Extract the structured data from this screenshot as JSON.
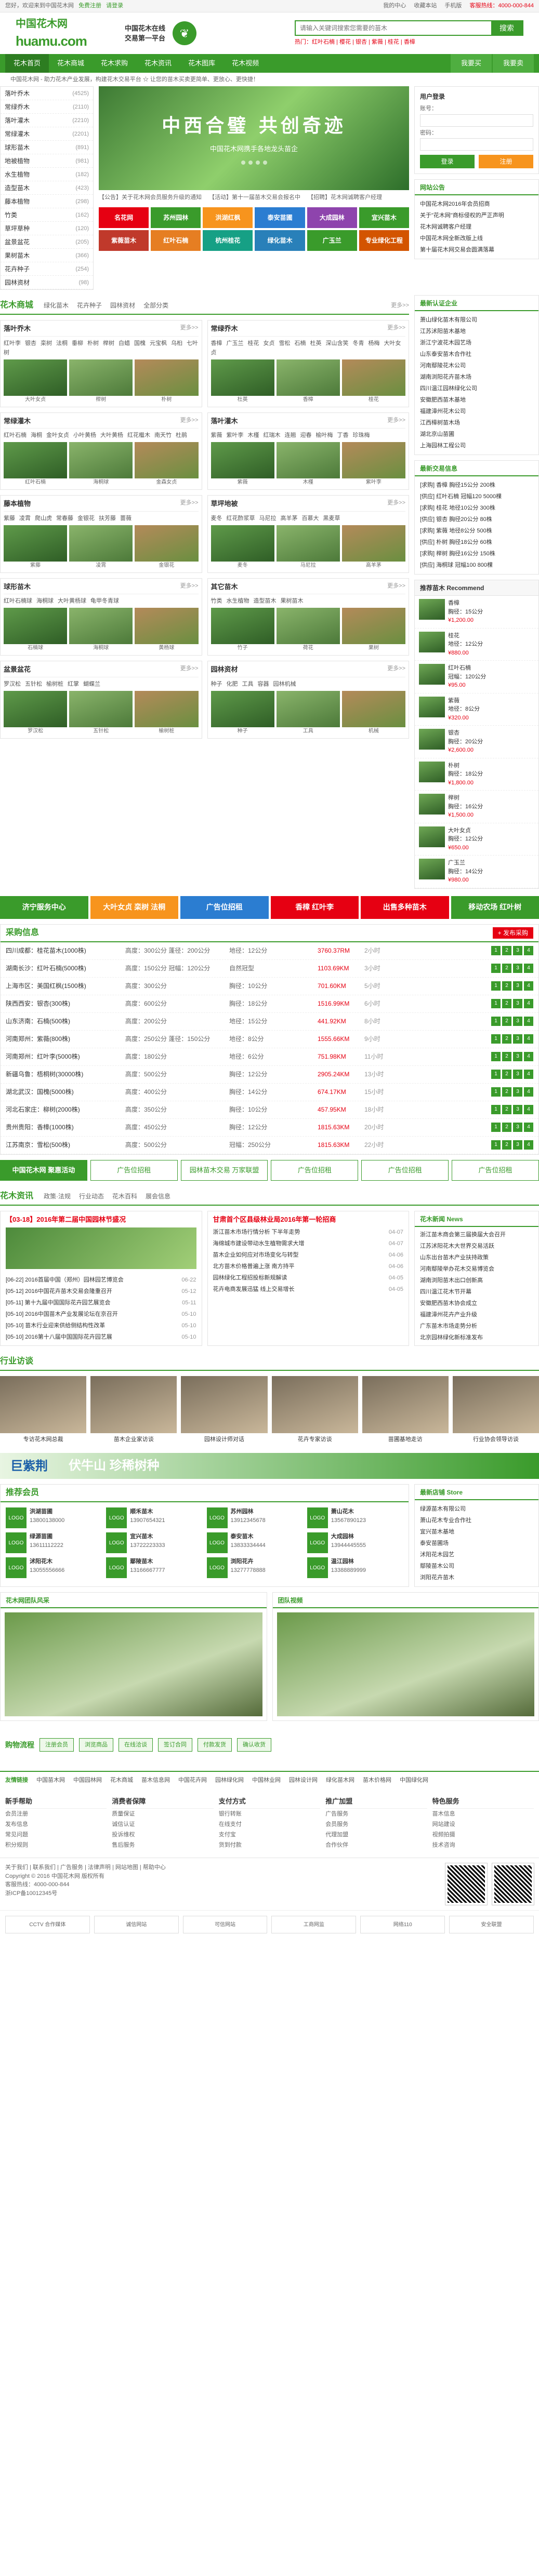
{
  "topbar": {
    "left": [
      "您好，欢迎来到中国花木网",
      "免费注册",
      "请登录"
    ],
    "right": [
      "我的中心",
      "收藏本站",
      "手机版",
      "客服热线：4000-000-844"
    ]
  },
  "logo": {
    "cn": "中国花木网",
    "en": "huamu.com"
  },
  "slogan": [
    "中国花木在线",
    "交易第一平台"
  ],
  "search": {
    "placeholder": "请输入关键词搜索您需要的苗木",
    "button": "搜索",
    "hot": "热门：红叶石楠 | 樱花 | 银杏 | 紫薇 | 桂花 | 香樟"
  },
  "nav": {
    "items": [
      "花木首页",
      "花木商城",
      "花木求购",
      "花木资讯",
      "花木图库",
      "花木视频"
    ],
    "right": [
      "我要买",
      "我要卖"
    ]
  },
  "ticker": "中国花木网 - 助力花木产业发展，构建花木交易平台 ☆ 让您的苗木买卖更简单、更放心、更快捷！",
  "categories": [
    {
      "name": "落叶乔木",
      "count": "(4525)"
    },
    {
      "name": "常绿乔木",
      "count": "(2110)"
    },
    {
      "name": "落叶灌木",
      "count": "(2210)"
    },
    {
      "name": "常绿灌木",
      "count": "(2201)"
    },
    {
      "name": "球形苗木",
      "count": "(891)"
    },
    {
      "name": "地被植物",
      "count": "(981)"
    },
    {
      "name": "水生植物",
      "count": "(182)"
    },
    {
      "name": "造型苗木",
      "count": "(423)"
    },
    {
      "name": "藤本植物",
      "count": "(298)"
    },
    {
      "name": "竹类",
      "count": "(162)"
    },
    {
      "name": "草坪草种",
      "count": "(120)"
    },
    {
      "name": "盆景盆花",
      "count": "(205)"
    },
    {
      "name": "果树苗木",
      "count": "(366)"
    },
    {
      "name": "花卉种子",
      "count": "(254)"
    },
    {
      "name": "园林资材",
      "count": "(98)"
    }
  ],
  "banner": {
    "title": "中西合璧 共创奇迹",
    "subtitle": "中国花木网携手各地龙头苗企"
  },
  "notices": [
    "【公告】关于花木网会员服务升级的通知",
    "【活动】第十一届苗木交易会报名中",
    "【招聘】花木网诚聘客户经理"
  ],
  "ads": [
    {
      "text": "名花网",
      "color": "#e60012"
    },
    {
      "text": "苏州园林",
      "color": "#3a9b2b"
    },
    {
      "text": "洪湖红枫",
      "color": "#f7941d"
    },
    {
      "text": "泰安苗圃",
      "color": "#2b7dd1"
    },
    {
      "text": "大成园林",
      "color": "#8e44ad"
    },
    {
      "text": "宜兴苗木",
      "color": "#3a9b2b"
    },
    {
      "text": "紫薇苗木",
      "color": "#c0392b"
    },
    {
      "text": "红叶石楠",
      "color": "#e67e22"
    },
    {
      "text": "杭州桂花",
      "color": "#16a085"
    },
    {
      "text": "绿化苗木",
      "color": "#2980b9"
    },
    {
      "text": "广玉兰",
      "color": "#3a9b2b"
    },
    {
      "text": "专业绿化工程",
      "color": "#d35400"
    }
  ],
  "login": {
    "title": "用户登录",
    "user": "账号：",
    "pass": "密码：",
    "login_btn": "登录",
    "reg_btn": "注册"
  },
  "notice_panel": {
    "title": "网站公告",
    "items": [
      "中国花木网2016年会员招商",
      "关于\"花木网\"商标侵权的严正声明",
      "花木网诚聘客户经理",
      "中国花木网全新改版上线",
      "第十届花木网交易会圆满落幕"
    ]
  },
  "mall": {
    "title": "花木商城",
    "tabs": [
      "绿化苗木",
      "花卉种子",
      "园林资材",
      "全部分类"
    ],
    "more": "更多>>"
  },
  "product_groups": [
    {
      "name": "落叶乔木",
      "tags": [
        "红叶李",
        "银杏",
        "栾树",
        "法桐",
        "垂柳",
        "朴树",
        "榉树",
        "白蜡",
        "国槐",
        "元宝枫",
        "乌桕",
        "七叶树"
      ],
      "caps": [
        "大叶女贞",
        "榉树",
        "朴树"
      ]
    },
    {
      "name": "常绿乔木",
      "tags": [
        "香樟",
        "广玉兰",
        "桂花",
        "女贞",
        "雪松",
        "石楠",
        "杜英",
        "深山含笑",
        "冬青",
        "杨梅",
        "大叶女贞"
      ],
      "caps": [
        "杜英",
        "香樟",
        "桂花"
      ]
    },
    {
      "name": "常绿灌木",
      "tags": [
        "红叶石楠",
        "海桐",
        "金叶女贞",
        "小叶黄杨",
        "大叶黄杨",
        "红花檵木",
        "南天竹",
        "杜鹃"
      ],
      "caps": [
        "红叶石楠",
        "海桐球",
        "金森女贞"
      ]
    },
    {
      "name": "落叶灌木",
      "tags": [
        "紫薇",
        "紫叶李",
        "木槿",
        "红瑞木",
        "连翘",
        "迎春",
        "榆叶梅",
        "丁香",
        "珍珠梅"
      ],
      "caps": [
        "紫薇",
        "木槿",
        "紫叶李"
      ]
    },
    {
      "name": "藤本植物",
      "tags": [
        "紫藤",
        "凌霄",
        "爬山虎",
        "常春藤",
        "金银花",
        "扶芳藤",
        "蔷薇"
      ],
      "caps": [
        "紫藤",
        "凌霄",
        "金银花"
      ]
    },
    {
      "name": "草坪地被",
      "tags": [
        "麦冬",
        "红花酢浆草",
        "马尼拉",
        "高羊茅",
        "百慕大",
        "黑麦草"
      ],
      "caps": [
        "麦冬",
        "马尼拉",
        "高羊茅"
      ]
    },
    {
      "name": "球形苗木",
      "tags": [
        "红叶石楠球",
        "海桐球",
        "大叶黄杨球",
        "龟甲冬青球"
      ],
      "caps": [
        "石楠球",
        "海桐球",
        "黄杨球"
      ]
    },
    {
      "name": "其它苗木",
      "tags": [
        "竹类",
        "水生植物",
        "造型苗木",
        "果树苗木"
      ],
      "caps": [
        "竹子",
        "荷花",
        "果树"
      ]
    },
    {
      "name": "盆景盆花",
      "tags": [
        "罗汉松",
        "五针松",
        "榆树桩",
        "红掌",
        "蝴蝶兰"
      ],
      "caps": [
        "罗汉松",
        "五针松",
        "榆树桩"
      ]
    },
    {
      "name": "园林资材",
      "tags": [
        "种子",
        "化肥",
        "工具",
        "容器",
        "园林机械"
      ],
      "caps": [
        "种子",
        "工具",
        "机械"
      ]
    }
  ],
  "recommend": {
    "title": "推荐苗木 Recommend",
    "items": [
      {
        "name": "香樟",
        "spec": "胸径：15公分",
        "price": "¥1,200.00"
      },
      {
        "name": "桂花",
        "spec": "地径：12公分",
        "price": "¥880.00"
      },
      {
        "name": "红叶石楠",
        "spec": "冠幅：120公分",
        "price": "¥95.00"
      },
      {
        "name": "紫薇",
        "spec": "地径：8公分",
        "price": "¥320.00"
      },
      {
        "name": "银杏",
        "spec": "胸径：20公分",
        "price": "¥2,600.00"
      },
      {
        "name": "朴树",
        "spec": "胸径：18公分",
        "price": "¥1,800.00"
      },
      {
        "name": "榉树",
        "spec": "胸径：16公分",
        "price": "¥1,500.00"
      },
      {
        "name": "大叶女贞",
        "spec": "胸径：12公分",
        "price": "¥650.00"
      },
      {
        "name": "广玉兰",
        "spec": "胸径：14公分",
        "price": "¥980.00"
      }
    ]
  },
  "company_panel": {
    "title": "最新认证企业",
    "items": [
      "萧山绿化苗木有限公司",
      "江苏沭阳苗木基地",
      "浙江宁波花木园艺场",
      "山东泰安苗木合作社",
      "河南鄢陵花木公司",
      "湖南浏阳花卉苗木场",
      "四川温江园林绿化公司",
      "安徽肥西苗木基地",
      "福建漳州花木公司",
      "江西樟树苗木场",
      "湖北京山苗圃",
      "上海园林工程公司"
    ]
  },
  "trade_panel": {
    "title": "最新交易信息",
    "items": [
      "[求购] 香樟 胸径15公分 200株",
      "[供应] 红叶石楠 冠幅120 5000棵",
      "[求购] 桂花 地径10公分 300株",
      "[供应] 银杏 胸径20公分 80株",
      "[求购] 紫薇 地径8公分 500株",
      "[供应] 朴树 胸径18公分 60株",
      "[求购] 榉树 胸径16公分 150株",
      "[供应] 海桐球 冠幅100 800棵"
    ]
  },
  "service_bar": [
    {
      "text": "济宁服务中心",
      "color": "#3a9b2b"
    },
    {
      "text": "大叶女贞 栾树 法桐",
      "color": "#f7941d"
    },
    {
      "text": "广告位招租",
      "color": "#2b7dd1"
    },
    {
      "text": "香樟 红叶李",
      "color": "#e60012"
    },
    {
      "text": "出售多种苗木",
      "color": "#e60012"
    },
    {
      "text": "移动农场 红叶树",
      "color": "#3a9b2b"
    }
  ],
  "buy": {
    "title": "采购信息",
    "post": "+ 发布采购",
    "rows": [
      {
        "loc": "四川成都：桂花苗木(1000株)",
        "spec": "高度：300公分 蓬径：200公分",
        "note": "地径：12公分",
        "price": "3760.37RM",
        "time": "2小时",
        "pages": [
          "1",
          "2",
          "3",
          "4"
        ]
      },
      {
        "loc": "湖南长沙：红叶石楠(5000株)",
        "spec": "高度：150公分 冠幅：120公分",
        "note": "自然冠型",
        "price": "1103.69KM",
        "time": "3小时",
        "pages": [
          "1",
          "2",
          "3",
          "4"
        ]
      },
      {
        "loc": "上海市区：美国红枫(1500株)",
        "spec": "高度：300公分",
        "note": "胸径：10公分",
        "price": "701.60KM",
        "time": "5小时",
        "pages": [
          "1",
          "2",
          "3",
          "4"
        ]
      },
      {
        "loc": "陕西西安：银杏(300株)",
        "spec": "高度：600公分",
        "note": "胸径：18公分",
        "price": "1516.99KM",
        "time": "6小时",
        "pages": [
          "1",
          "2",
          "3",
          "4"
        ]
      },
      {
        "loc": "山东济南：石楠(500株)",
        "spec": "高度：200公分",
        "note": "地径：15公分",
        "price": "441.92KM",
        "time": "8小时",
        "pages": [
          "1",
          "2",
          "3",
          "4"
        ]
      },
      {
        "loc": "河南郑州：紫薇(800株)",
        "spec": "高度：250公分 蓬径：150公分",
        "note": "地径：8公分",
        "price": "1555.66KM",
        "time": "9小时",
        "pages": [
          "1",
          "2",
          "3",
          "4"
        ]
      },
      {
        "loc": "河南郑州：红叶李(5000株)",
        "spec": "高度：180公分",
        "note": "地径：6公分",
        "price": "751.98KM",
        "time": "11小时",
        "pages": [
          "1",
          "2",
          "3",
          "4"
        ]
      },
      {
        "loc": "新疆乌鲁：梧桐树(30000株)",
        "spec": "高度：500公分",
        "note": "胸径：12公分",
        "price": "2905.24KM",
        "time": "13小时",
        "pages": [
          "1",
          "2",
          "3",
          "4"
        ]
      },
      {
        "loc": "湖北武汉：国槐(5000株)",
        "spec": "高度：400公分",
        "note": "胸径：14公分",
        "price": "674.17KM",
        "time": "15小时",
        "pages": [
          "1",
          "2",
          "3",
          "4"
        ]
      },
      {
        "loc": "河北石家庄：柳树(2000株)",
        "spec": "高度：350公分",
        "note": "胸径：10公分",
        "price": "457.95KM",
        "time": "18小时",
        "pages": [
          "1",
          "2",
          "3",
          "4"
        ]
      },
      {
        "loc": "贵州贵阳：香樟(1000株)",
        "spec": "高度：450公分",
        "note": "胸径：12公分",
        "price": "1815.63KM",
        "time": "20小时",
        "pages": [
          "1",
          "2",
          "3",
          "4"
        ]
      },
      {
        "loc": "江苏南京：雪松(500株)",
        "spec": "高度：500公分",
        "note": "冠幅：250公分",
        "price": "1815.63KM",
        "time": "22小时",
        "pages": [
          "1",
          "2",
          "3",
          "4"
        ]
      }
    ]
  },
  "ad_row": [
    "中国花木网 聚惠活动",
    "广告位招租",
    "园林苗木交易 万家联盟",
    "广告位招租",
    "广告位招租",
    "广告位招租"
  ],
  "news": {
    "title": "花木资讯",
    "tabs": [
      "政策·法规",
      "行业动态",
      "花木百科",
      "展会信息"
    ],
    "headline": "【03-18】2016年第二届中国园林节盛况",
    "left": [
      {
        "t": "[06-22] 2016首届中国（郑州）园林园艺博览会",
        "d": "06-22"
      },
      {
        "t": "[05-12] 2016中国花卉苗木交易会隆重召开",
        "d": "05-12"
      },
      {
        "t": "[05-11] 第十九届中国国际花卉园艺展览会",
        "d": "05-11"
      },
      {
        "t": "[05-10] 2016中国苗木产业发展论坛在京召开",
        "d": "05-10"
      },
      {
        "t": "[05-10] 苗木行业迎来供给侧结构性改革",
        "d": "05-10"
      },
      {
        "t": "[05-10] 2016第十八届中国国际花卉园艺展",
        "d": "05-10"
      }
    ],
    "mid_headline": "甘肃首个区县级林业局2016年第一轮招商",
    "mid": [
      {
        "t": "浙江苗木市场行情分析 下半年走势",
        "d": "04-07"
      },
      {
        "t": "海绵城市建设带动水生植物需求大增",
        "d": "04-07"
      },
      {
        "t": "苗木企业如何应对市场变化与转型",
        "d": "04-06"
      },
      {
        "t": "北方苗木价格普遍上涨 南方持平",
        "d": "04-06"
      },
      {
        "t": "园林绿化工程招投标新规解读",
        "d": "04-05"
      },
      {
        "t": "花卉电商发展迅猛 线上交易增长",
        "d": "04-05"
      }
    ],
    "right_title": "花木新闻 News",
    "right": [
      "浙江苗木商会第三届换届大会召开",
      "江苏沭阳花木大世界交易活跃",
      "山东出台苗木产业扶持政策",
      "河南鄢陵举办花木交易博览会",
      "湖南浏阳苗木出口创新高",
      "四川温江花木节开幕",
      "安徽肥西苗木协会成立",
      "福建漳州花卉产业升级",
      "广东苗木市场走势分析",
      "北京园林绿化新标准发布"
    ]
  },
  "interviews": {
    "title": "行业访谈",
    "items": [
      "专访花木网总裁",
      "苗木企业家访谈",
      "园林设计师对话",
      "花卉专家访谈",
      "苗圃基地走访",
      "行业协会领导访谈"
    ]
  },
  "big_ad": {
    "left": "巨紫荆",
    "right": "伏牛山 珍稀树种"
  },
  "members": {
    "title": "推荐会员",
    "items": [
      {
        "name": "洪湖苗圃",
        "phone": "13800138000"
      },
      {
        "name": "顺禾苗木",
        "phone": "13907654321"
      },
      {
        "name": "苏州园林",
        "phone": "13912345678"
      },
      {
        "name": "萧山花木",
        "phone": "13567890123"
      },
      {
        "name": "绿源苗圃",
        "phone": "13611112222"
      },
      {
        "name": "宜兴苗木",
        "phone": "13722223333"
      },
      {
        "name": "泰安苗木",
        "phone": "13833334444"
      },
      {
        "name": "大成园林",
        "phone": "13944445555"
      },
      {
        "name": "沭阳花木",
        "phone": "13055556666"
      },
      {
        "name": "鄢陵苗木",
        "phone": "13166667777"
      },
      {
        "name": "浏阳花卉",
        "phone": "13277778888"
      },
      {
        "name": "温江园林",
        "phone": "13388889999"
      }
    ],
    "side_title": "最新店铺 Store",
    "side": [
      "绿源苗木有限公司",
      "萧山花木专业合作社",
      "宜兴苗木基地",
      "泰安苗圃场",
      "沭阳花木园艺",
      "鄢陵苗木公司",
      "浏阳花卉苗木"
    ]
  },
  "photos": {
    "left": "花木网团队风采",
    "right": "团队视频"
  },
  "buyflow": {
    "label": "购物流程",
    "steps": [
      "注册会员",
      "浏览商品",
      "在线洽谈",
      "签订合同",
      "付款发货",
      "确认收货"
    ]
  },
  "links": {
    "title": "友情链接",
    "items": [
      "中国苗木网",
      "中国园林网",
      "花木商城",
      "苗木信息网",
      "中国花卉网",
      "园林绿化网",
      "中国林业网",
      "园林设计网",
      "绿化苗木网",
      "苗木价格网",
      "中国绿化网"
    ]
  },
  "help": [
    {
      "t": "新手帮助",
      "items": [
        "会员注册",
        "发布信息",
        "常见问题",
        "积分规则"
      ]
    },
    {
      "t": "消费者保障",
      "items": [
        "质量保证",
        "诚信认证",
        "投诉维权",
        "售后服务"
      ]
    },
    {
      "t": "支付方式",
      "items": [
        "银行转账",
        "在线支付",
        "支付宝",
        "货到付款"
      ]
    },
    {
      "t": "推广加盟",
      "items": [
        "广告服务",
        "会员服务",
        "代理加盟",
        "合作伙伴"
      ]
    },
    {
      "t": "特色服务",
      "items": [
        "苗木信息",
        "网站建设",
        "视频拍摄",
        "技术咨询"
      ]
    }
  ],
  "footer": {
    "links": "关于我们 | 联系我们 | 广告服务 | 法律声明 | 网站地图 | 帮助中心",
    "copy": "Copyright © 2016 中国花木网 版权所有",
    "tel": "客服热线：4000-000-844",
    "icp": "浙ICP备10012345号"
  },
  "badges": [
    "CCTV 合作媒体",
    "诚信网站",
    "可信网站",
    "工商网监",
    "网络110",
    "安全联盟"
  ],
  "colors": {
    "primary": "#3a9b2b",
    "accent": "#e60012",
    "orange": "#f7941d"
  }
}
